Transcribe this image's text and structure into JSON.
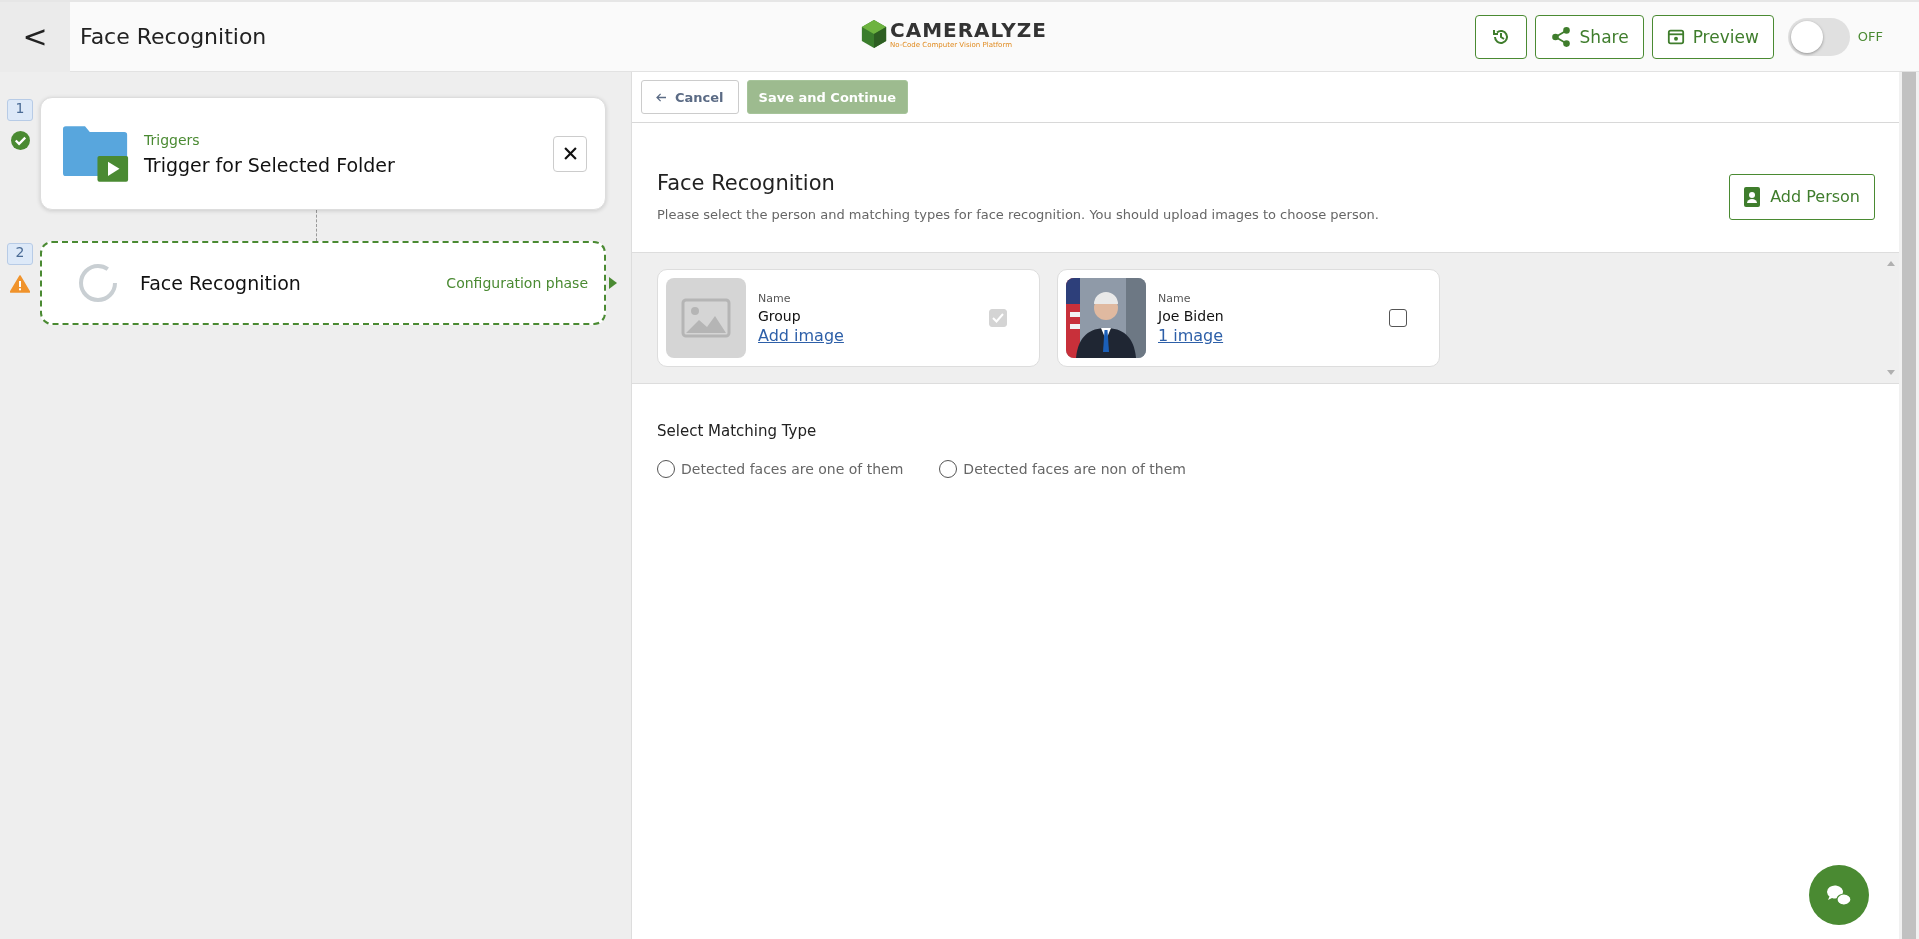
{
  "header": {
    "back": "<",
    "title": "Face Recognition",
    "logo": {
      "name": "CAMERALYZE",
      "tagline": "No-Code Computer Vision Platform"
    },
    "buttons": [
      {
        "kind": "history"
      },
      {
        "kind": "share",
        "label": "Share"
      },
      {
        "kind": "preview",
        "label": "Preview"
      }
    ],
    "toggle": {
      "on": false,
      "label": "OFF"
    }
  },
  "flow": [
    {
      "number": "1",
      "done": true,
      "category": "Triggers",
      "title": "Trigger for Selected Folder",
      "kind": "trigger",
      "active": false
    },
    {
      "number": "2",
      "done": false,
      "title": "Face Recognition",
      "phase": "Configuration phase",
      "kind": "step",
      "active": true
    }
  ],
  "toolbar": {
    "cancel": "Cancel",
    "save": {
      "label": "Save and Continue",
      "disabled": true
    }
  },
  "panel": {
    "title": "Face Recognition",
    "description": "Please select the person and matching types for face recognition. You should upload images to choose person.",
    "add_button": "Add Person"
  },
  "persons": [
    {
      "name_label": "Name",
      "name": "Group",
      "link": "Add image",
      "kind": "placeholder",
      "checked": true,
      "disabled": true
    },
    {
      "name_label": "Name",
      "name": "Joe Biden",
      "link": "1 image",
      "kind": "picture",
      "checked": false,
      "disabled": false
    }
  ],
  "matching": {
    "title": "Select Matching Type",
    "options": [
      {
        "label": "Detected faces are one of them",
        "selected": false
      },
      {
        "label": "Detected faces are non of them",
        "selected": false
      }
    ]
  }
}
